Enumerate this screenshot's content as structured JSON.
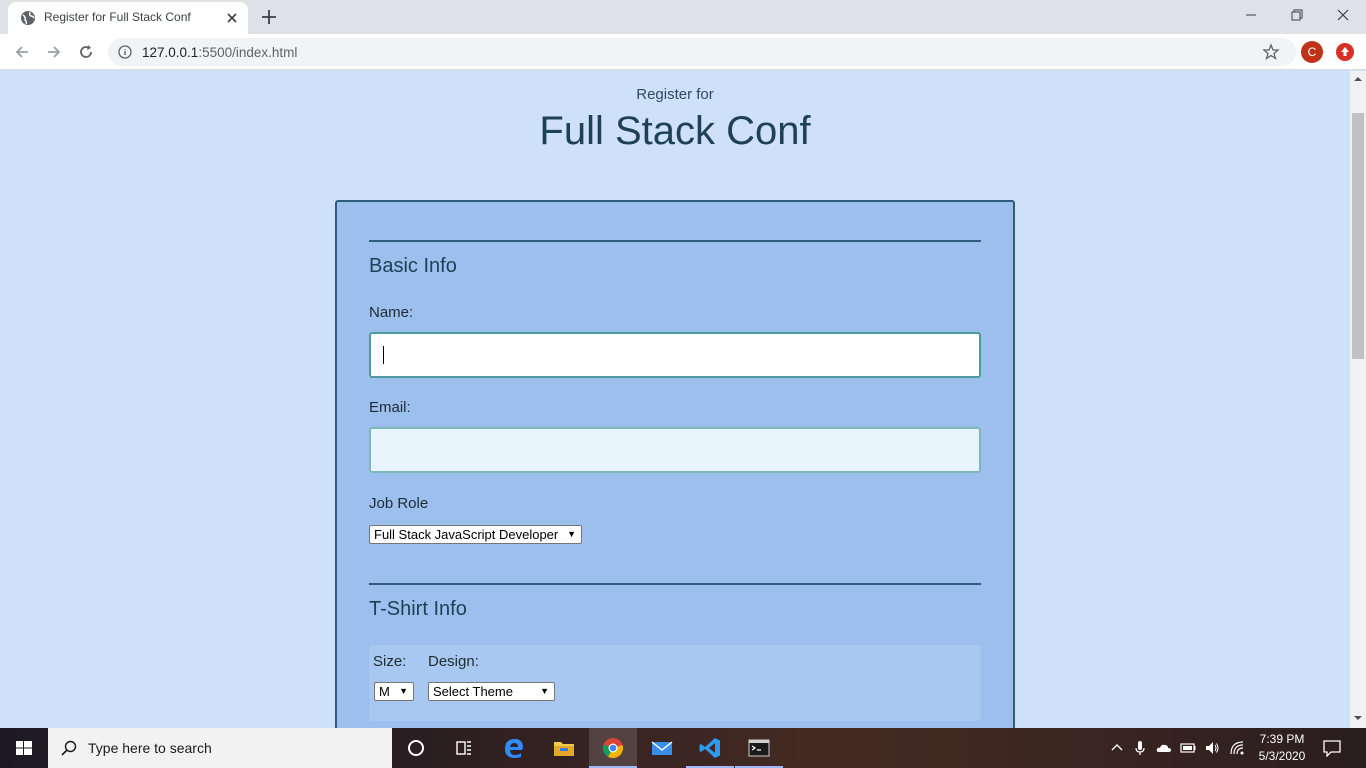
{
  "browser": {
    "tab_title": "Register for Full Stack Conf",
    "url_host": "127.0.0.1",
    "url_rest": ":5500/index.html",
    "profile_initial": "C"
  },
  "page": {
    "pre_title": "Register for",
    "title": "Full Stack Conf",
    "basic_info": {
      "heading": "Basic Info",
      "name_label": "Name:",
      "name_value": "",
      "email_label": "Email:",
      "email_value": "",
      "job_role_label": "Job Role",
      "job_role_selected": "Full Stack JavaScript Developer"
    },
    "tshirt_info": {
      "heading": "T-Shirt Info",
      "size_label": "Size:",
      "size_selected": "M",
      "design_label": "Design:",
      "design_selected": "Select Theme"
    }
  },
  "taskbar": {
    "search_placeholder": "Type here to search",
    "time": "7:39 PM",
    "date": "5/3/2020"
  },
  "colors": {
    "page_bg": "#cfe0f9",
    "card_bg": "#9dbfee",
    "accent_border": "#2d5d7b",
    "title_text": "#1e4254"
  }
}
